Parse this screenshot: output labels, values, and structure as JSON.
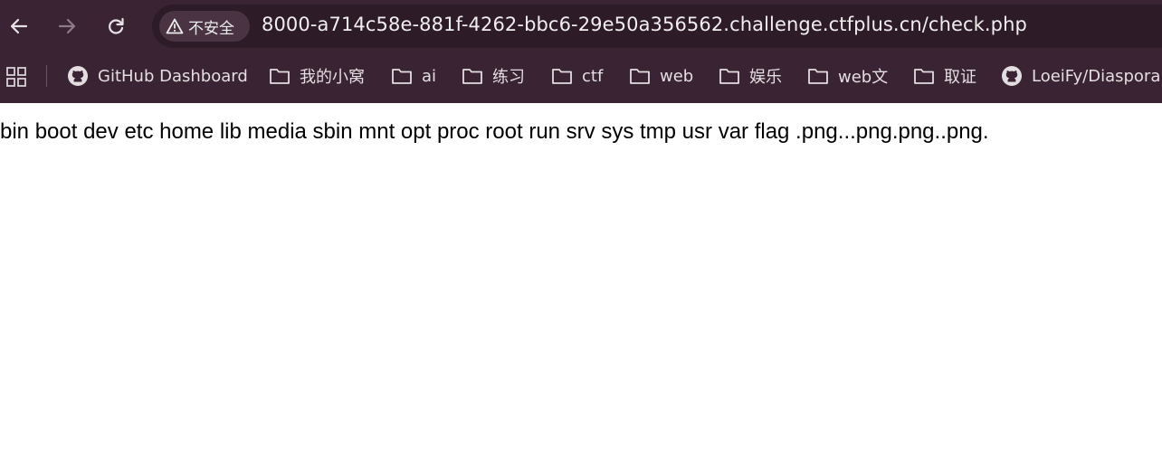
{
  "browser": {
    "security_label": "不安全",
    "url": "8000-a714c58e-881f-4262-bbc6-29e50a356562.challenge.ctfplus.cn/check.php"
  },
  "bookmarks": [
    {
      "label": "GitHub Dashboard",
      "icon": "github-icon"
    },
    {
      "label": "我的小窝",
      "icon": "folder-icon"
    },
    {
      "label": "ai",
      "icon": "folder-icon"
    },
    {
      "label": "练习",
      "icon": "folder-icon"
    },
    {
      "label": "ctf",
      "icon": "folder-icon"
    },
    {
      "label": "web",
      "icon": "folder-icon"
    },
    {
      "label": "娱乐",
      "icon": "folder-icon"
    },
    {
      "label": "web文",
      "icon": "folder-icon"
    },
    {
      "label": "取证",
      "icon": "folder-icon"
    },
    {
      "label": "LoeiFy/Diaspora:",
      "icon": "github-icon"
    }
  ],
  "page": {
    "output_text": "bin boot dev etc home lib media sbin mnt opt proc root run srv sys tmp usr var flag .png...png.png..png."
  },
  "colors": {
    "toolbar_bg": "#3a2433",
    "omnibox_bg": "#2d1b28",
    "chip_bg": "#4a3443"
  }
}
